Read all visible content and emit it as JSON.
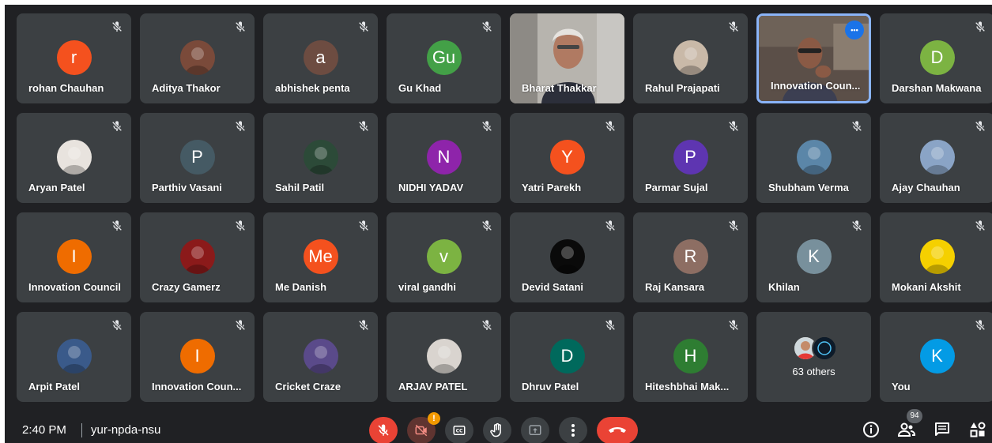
{
  "participants": [
    {
      "name": "rohan Chauhan",
      "avatar": "letter",
      "initial": "r",
      "color": "#f4511e"
    },
    {
      "name": "Aditya Thakor",
      "avatar": "photo",
      "photo_tone": "#7a4a3a"
    },
    {
      "name": "abhishek penta",
      "avatar": "letter",
      "initial": "a",
      "color": "#6d4c41"
    },
    {
      "name": "Gu Khad",
      "avatar": "letter",
      "initial": "Gu",
      "color": "#43a047"
    },
    {
      "name": "Bharat Thakkar",
      "avatar": "video"
    },
    {
      "name": "Rahul Prajapati",
      "avatar": "photo",
      "photo_tone": "#c9b9a8"
    },
    {
      "name": "Innovation Coun...",
      "avatar": "video",
      "active": true
    },
    {
      "name": "Darshan Makwana",
      "avatar": "letter",
      "initial": "D",
      "color": "#7cb342"
    },
    {
      "name": "Aryan Patel",
      "avatar": "photo",
      "photo_tone": "#e8e3de"
    },
    {
      "name": "Parthiv Vasani",
      "avatar": "letter",
      "initial": "P",
      "color": "#455a64"
    },
    {
      "name": "Sahil Patil",
      "avatar": "photo",
      "photo_tone": "#2c4a38"
    },
    {
      "name": "NIDHI YADAV",
      "avatar": "letter",
      "initial": "N",
      "color": "#8e24aa"
    },
    {
      "name": "Yatri Parekh",
      "avatar": "letter",
      "initial": "Y",
      "color": "#f4511e"
    },
    {
      "name": "Parmar Sujal",
      "avatar": "letter",
      "initial": "P",
      "color": "#5e35b1"
    },
    {
      "name": "Shubham Verma",
      "avatar": "photo",
      "photo_tone": "#5b86a8"
    },
    {
      "name": "Ajay Chauhan",
      "avatar": "photo",
      "photo_tone": "#8aa4c6"
    },
    {
      "name": "Innovation Council",
      "avatar": "letter",
      "initial": "I",
      "color": "#ef6c00"
    },
    {
      "name": "Crazy Gamerz",
      "avatar": "photo",
      "photo_tone": "#8b1a1a"
    },
    {
      "name": "Me Danish",
      "avatar": "letter",
      "initial": "Me",
      "color": "#f4511e"
    },
    {
      "name": "viral gandhi",
      "avatar": "letter",
      "initial": "v",
      "color": "#7cb342"
    },
    {
      "name": "Devid Satani",
      "avatar": "photo",
      "photo_tone": "#0a0a0a"
    },
    {
      "name": "Raj Kansara",
      "avatar": "letter",
      "initial": "R",
      "color": "#8d6e63"
    },
    {
      "name": "Khilan",
      "avatar": "letter",
      "initial": "K",
      "color": "#78909c"
    },
    {
      "name": "Mokani Akshit",
      "avatar": "photo",
      "photo_tone": "#f5d000"
    },
    {
      "name": "Arpit Patel",
      "avatar": "photo",
      "photo_tone": "#3a5a8a"
    },
    {
      "name": "Innovation Coun...",
      "avatar": "letter",
      "initial": "I",
      "color": "#ef6c00"
    },
    {
      "name": "Cricket Craze",
      "avatar": "photo",
      "photo_tone": "#5a4a8a"
    },
    {
      "name": "ARJAV PATEL",
      "avatar": "photo",
      "photo_tone": "#d9d4cf"
    },
    {
      "name": "Dhruv Patel",
      "avatar": "letter",
      "initial": "D",
      "color": "#00695c"
    },
    {
      "name": "Hiteshbhai Mak...",
      "avatar": "letter",
      "initial": "H",
      "color": "#2e7d32"
    },
    {
      "name": "",
      "avatar": "others",
      "others_label": "63 others"
    },
    {
      "name": "You",
      "avatar": "letter",
      "initial": "K",
      "color": "#039be5"
    }
  ],
  "bottom_bar": {
    "time": "2:40 PM",
    "meeting_code": "yur-npda-nsu",
    "camera_alert_badge": "!",
    "people_count": "94"
  },
  "icons": {
    "muted": "mic-off-icon",
    "controls": [
      "mic-off-icon",
      "camera-off-icon",
      "captions-icon",
      "raise-hand-icon",
      "present-icon",
      "more-options-icon",
      "end-call-icon"
    ],
    "right": [
      "info-icon",
      "people-icon",
      "chat-icon",
      "activities-icon"
    ]
  },
  "colors": {
    "background": "#202124",
    "tile": "#3c4043",
    "active_border": "#8ab4f8",
    "danger": "#ea4335"
  }
}
